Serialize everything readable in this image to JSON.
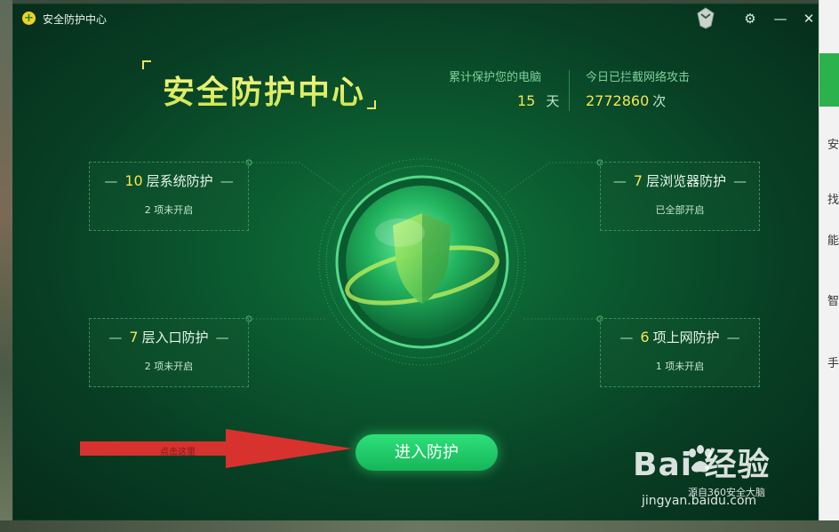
{
  "window": {
    "title": "安全防护中心",
    "controls": {
      "settings": "⚙",
      "minimize": "—",
      "close": "✕"
    }
  },
  "header": {
    "title": "安全防护中心"
  },
  "stats": {
    "protect_label": "累计保护您的电脑",
    "protect_value": "15",
    "protect_unit": "天",
    "block_label": "今日已拦截网络攻击",
    "block_value": "2772860",
    "block_unit": "次"
  },
  "cards": {
    "system": {
      "num": "10",
      "title": "层系统防护",
      "status": "2 项未开启"
    },
    "browser": {
      "num": "7",
      "title": "层浏览器防护",
      "status": "已全部开启"
    },
    "entry": {
      "num": "7",
      "title": "层入口防护",
      "status": "2 项未开启"
    },
    "web": {
      "num": "6",
      "title": "项上网防护",
      "status": "1 项未开启"
    }
  },
  "actions": {
    "enter_label": "进入防护"
  },
  "annotation": {
    "arrow_text": "点击这里"
  },
  "watermark": {
    "brand": "Bai 经验",
    "url": "jingyan.baidu.com",
    "source": "源自360安全大脑"
  },
  "side": {
    "chars": [
      "安",
      "找",
      "能",
      "智",
      "手"
    ]
  },
  "colors": {
    "accent_yellow": "#f4e45a",
    "button_green": "#16b659",
    "arrow_red": "#d8322e",
    "bg_dark": "#062c1a"
  }
}
